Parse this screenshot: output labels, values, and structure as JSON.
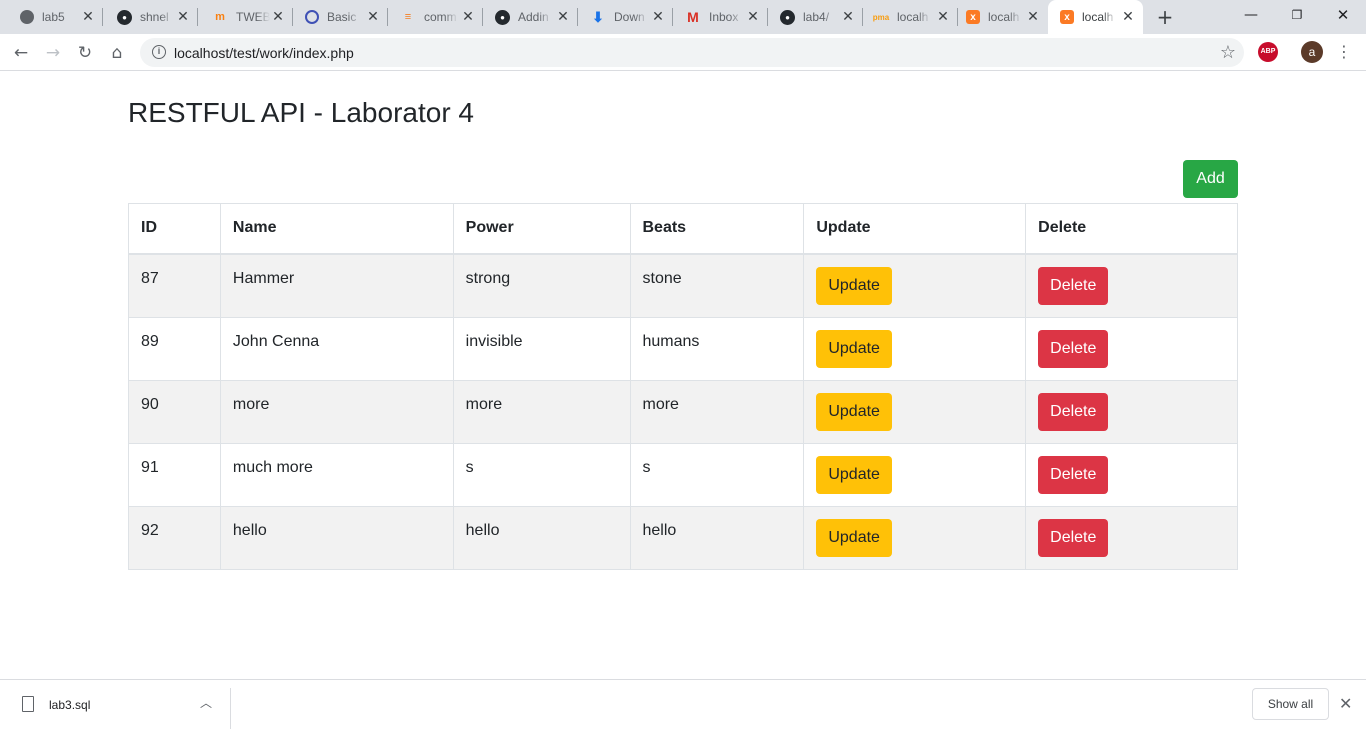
{
  "browser": {
    "tabs": [
      {
        "title": "lab5",
        "icon": "globe-icon"
      },
      {
        "title": "shnel",
        "icon": "github-icon"
      },
      {
        "title": "TWEB",
        "icon": "moodle-icon"
      },
      {
        "title": "Basic",
        "icon": "circle-icon"
      },
      {
        "title": "comm",
        "icon": "stackoverflow-icon"
      },
      {
        "title": "Addin",
        "icon": "github-icon"
      },
      {
        "title": "Down",
        "icon": "download-icon"
      },
      {
        "title": "Inbox",
        "icon": "gmail-icon"
      },
      {
        "title": "lab4/",
        "icon": "github-icon"
      },
      {
        "title": "localh",
        "icon": "phpmyadmin-icon"
      },
      {
        "title": "localh",
        "icon": "xampp-icon"
      },
      {
        "title": "localh",
        "icon": "xampp-icon"
      }
    ],
    "url": "localhost/test/work/index.php",
    "avatar_letter": "a",
    "abp_label": "ABP"
  },
  "page": {
    "title": "RESTFUL API - Laborator 4",
    "add_label": "Add",
    "table": {
      "headers": [
        "ID",
        "Name",
        "Power",
        "Beats",
        "Update",
        "Delete"
      ],
      "rows": [
        {
          "id": "87",
          "name": "Hammer",
          "power": "strong",
          "beats": "stone"
        },
        {
          "id": "89",
          "name": "John Cenna",
          "power": "invisible",
          "beats": "humans"
        },
        {
          "id": "90",
          "name": "more",
          "power": "more",
          "beats": "more"
        },
        {
          "id": "91",
          "name": "much more",
          "power": "s",
          "beats": "s"
        },
        {
          "id": "92",
          "name": "hello",
          "power": "hello",
          "beats": "hello"
        }
      ],
      "update_label": "Update",
      "delete_label": "Delete"
    }
  },
  "downloads": {
    "file_name": "lab3.sql",
    "show_all_label": "Show all"
  },
  "colors": {
    "add": "#28a745",
    "update": "#ffc107",
    "delete": "#dc3545",
    "stripe": "#f2f2f2"
  }
}
